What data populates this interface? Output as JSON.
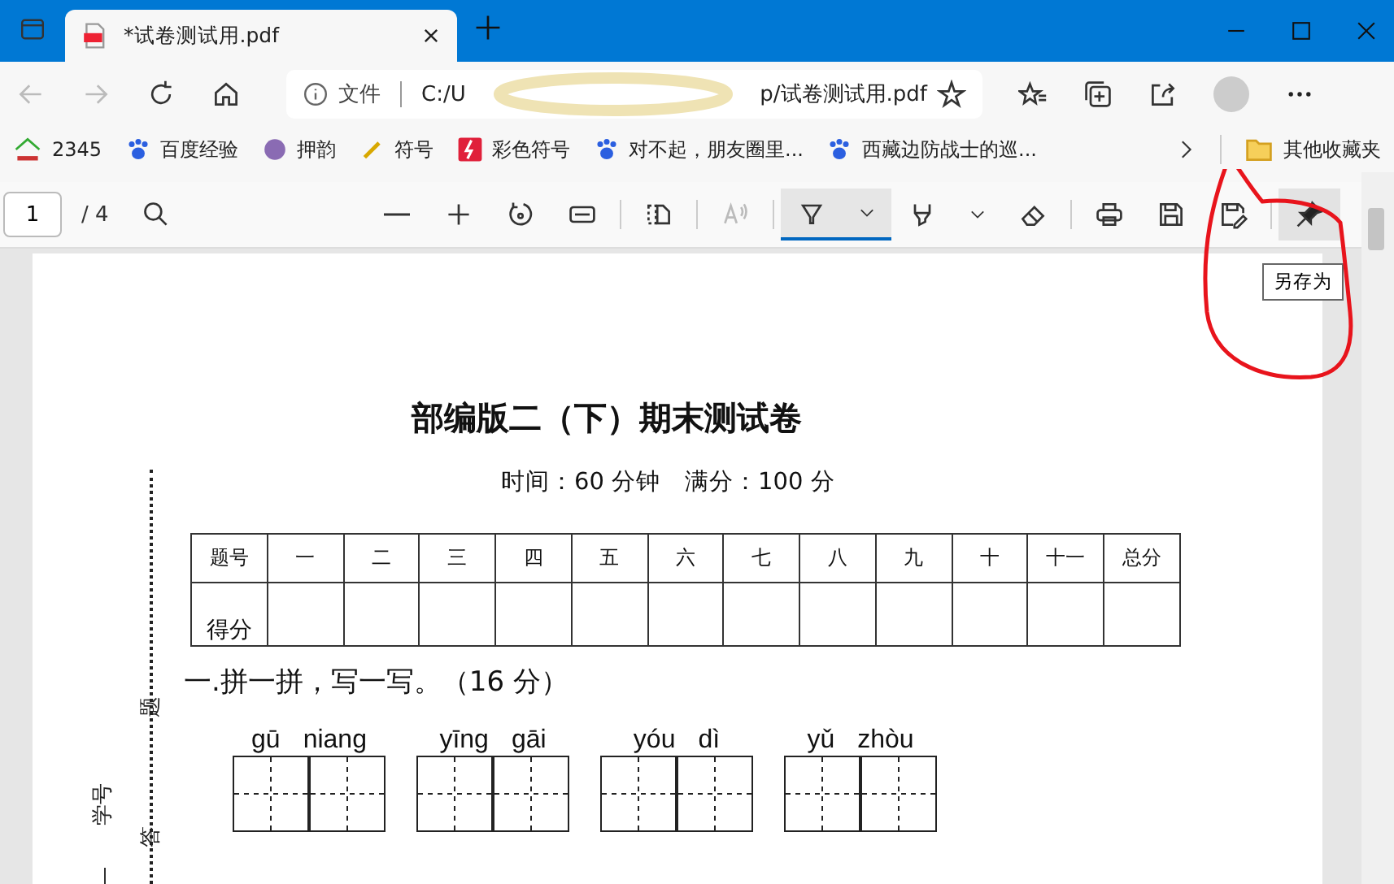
{
  "window": {
    "tab_title": "*试卷测试用.pdf"
  },
  "address_bar": {
    "scheme_label": "文件",
    "url_start": "C:/U",
    "url_end": "p/试卷测试用.pdf"
  },
  "bookmarks": [
    {
      "kind": "house",
      "label": "2345"
    },
    {
      "kind": "paw",
      "label": "百度经验"
    },
    {
      "kind": "disc",
      "label": "押韵"
    },
    {
      "kind": "pencil",
      "label": "符号"
    },
    {
      "kind": "bolt",
      "label": "彩色符号"
    },
    {
      "kind": "paw",
      "label": "对不起，朋友圈里..."
    },
    {
      "kind": "paw",
      "label": "西藏边防战士的巡..."
    }
  ],
  "other_bookmarks": "其他收藏夹",
  "pdf_toolbar": {
    "page": "1",
    "page_count": "/ 4",
    "tools": [
      {
        "kind": "highlighter",
        "selected": true
      },
      {
        "kind": "marker",
        "selected": false
      },
      {
        "kind": "eraser",
        "selected": false
      }
    ],
    "tooltip": "另存为"
  },
  "document": {
    "title": "部编版二（下）期末测试卷",
    "subtitle": "时间：60 分钟　满分：100 分",
    "score_table": {
      "header": [
        "题号",
        "一",
        "二",
        "三",
        "四",
        "五",
        "六",
        "七",
        "八",
        "九",
        "十",
        "十一",
        "总分"
      ],
      "row_label": "得分"
    },
    "section_heading": "一.拼一拼，写一写。（16 分）",
    "margin_labels": [
      "题",
      "答"
    ],
    "student_id_label": "学号",
    "pinyin_words": [
      [
        "gū",
        "niang"
      ],
      [
        "yīng",
        "gāi"
      ],
      [
        "yóu",
        "dì"
      ],
      [
        "yǔ",
        "zhòu"
      ]
    ]
  }
}
